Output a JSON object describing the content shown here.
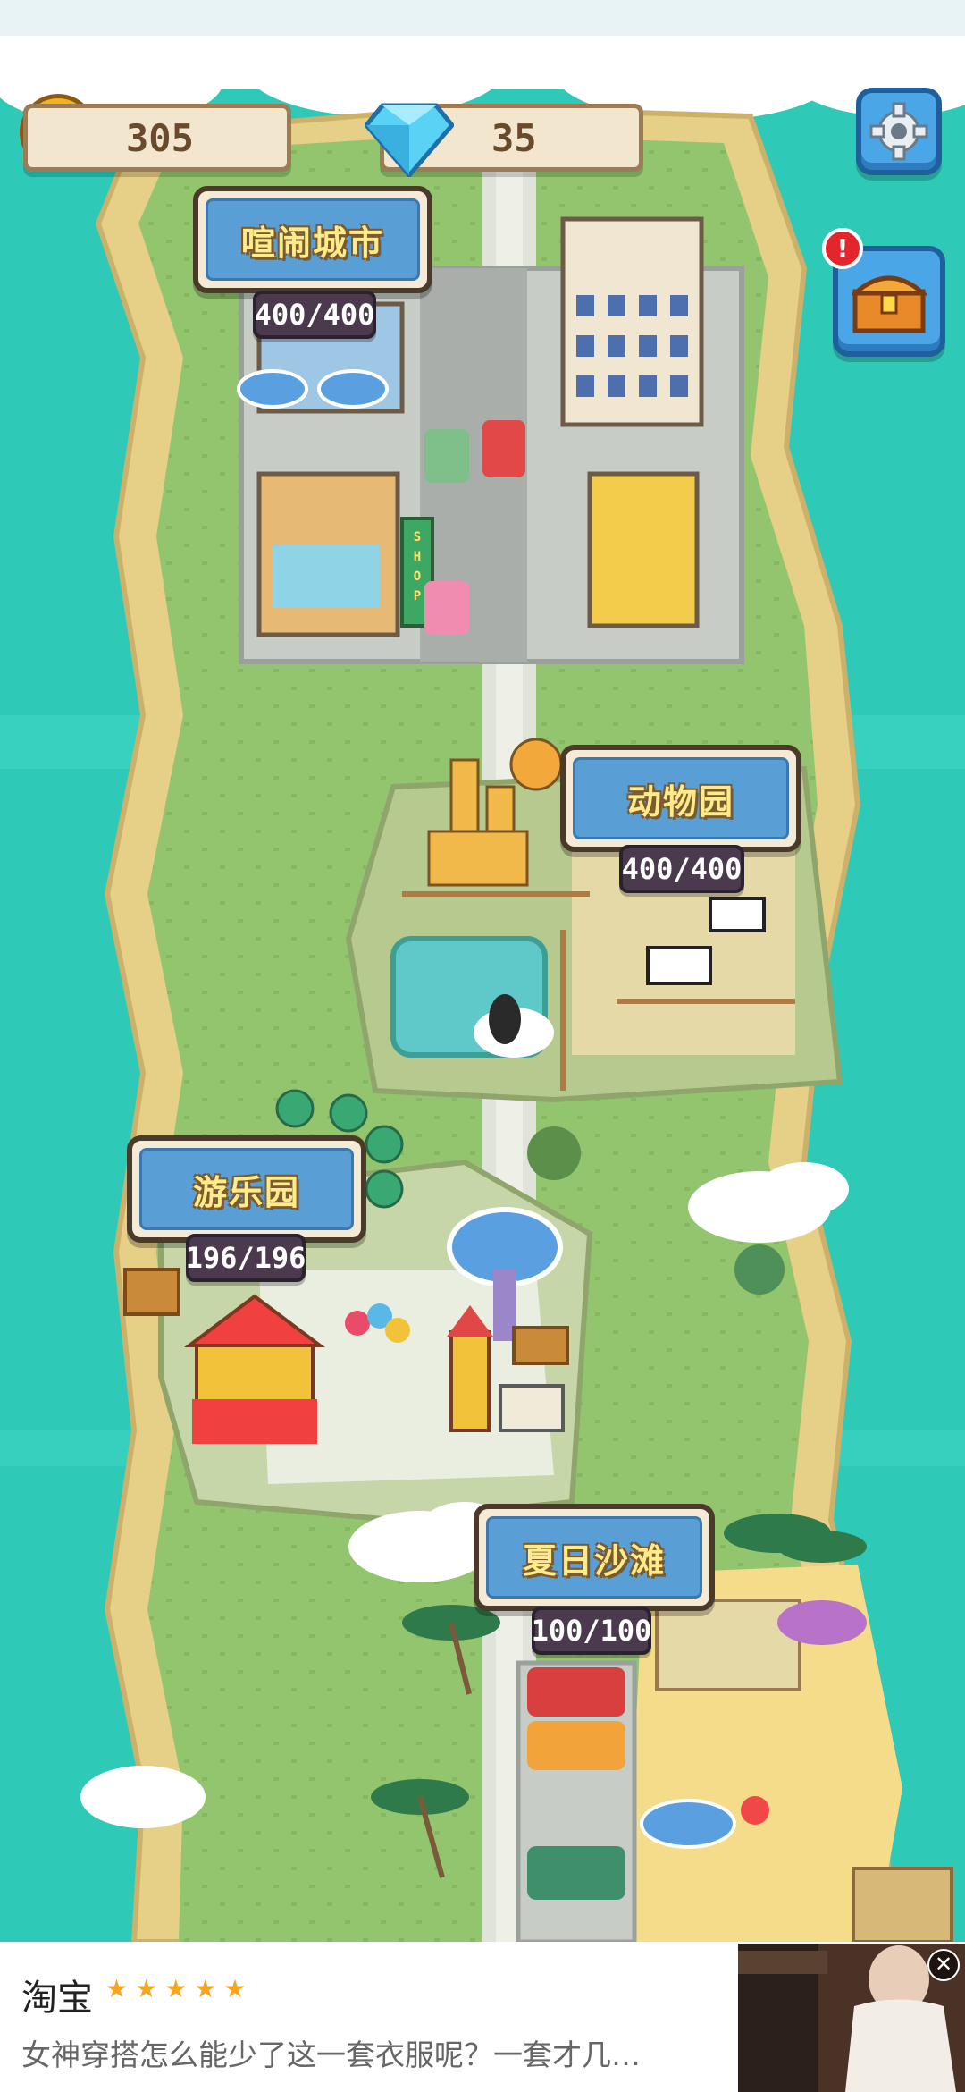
{
  "hud": {
    "coins": "305",
    "gems": "35",
    "settings_icon": "gear-icon",
    "chest_icon": "treasure-chest-icon",
    "alert_badge": "!"
  },
  "areas": [
    {
      "name": "喧闹城市",
      "capacity": "400/400"
    },
    {
      "name": "动物园",
      "capacity": "400/400"
    },
    {
      "name": "游乐园",
      "capacity": "196/196"
    },
    {
      "name": "夏日沙滩",
      "capacity": "100/100"
    }
  ],
  "shop_sign": "SHOP",
  "ad": {
    "title": "淘宝",
    "stars": "★★★★★",
    "description": "女神穿搭怎么能少了这一套衣服呢？一套才几…",
    "close": "✕"
  },
  "colors": {
    "sea": "#2fc9b7",
    "grass": "#93c56e",
    "sand": "#e6cf86",
    "label_blue": "#5a9ed6",
    "label_text": "#ffeb8a"
  }
}
